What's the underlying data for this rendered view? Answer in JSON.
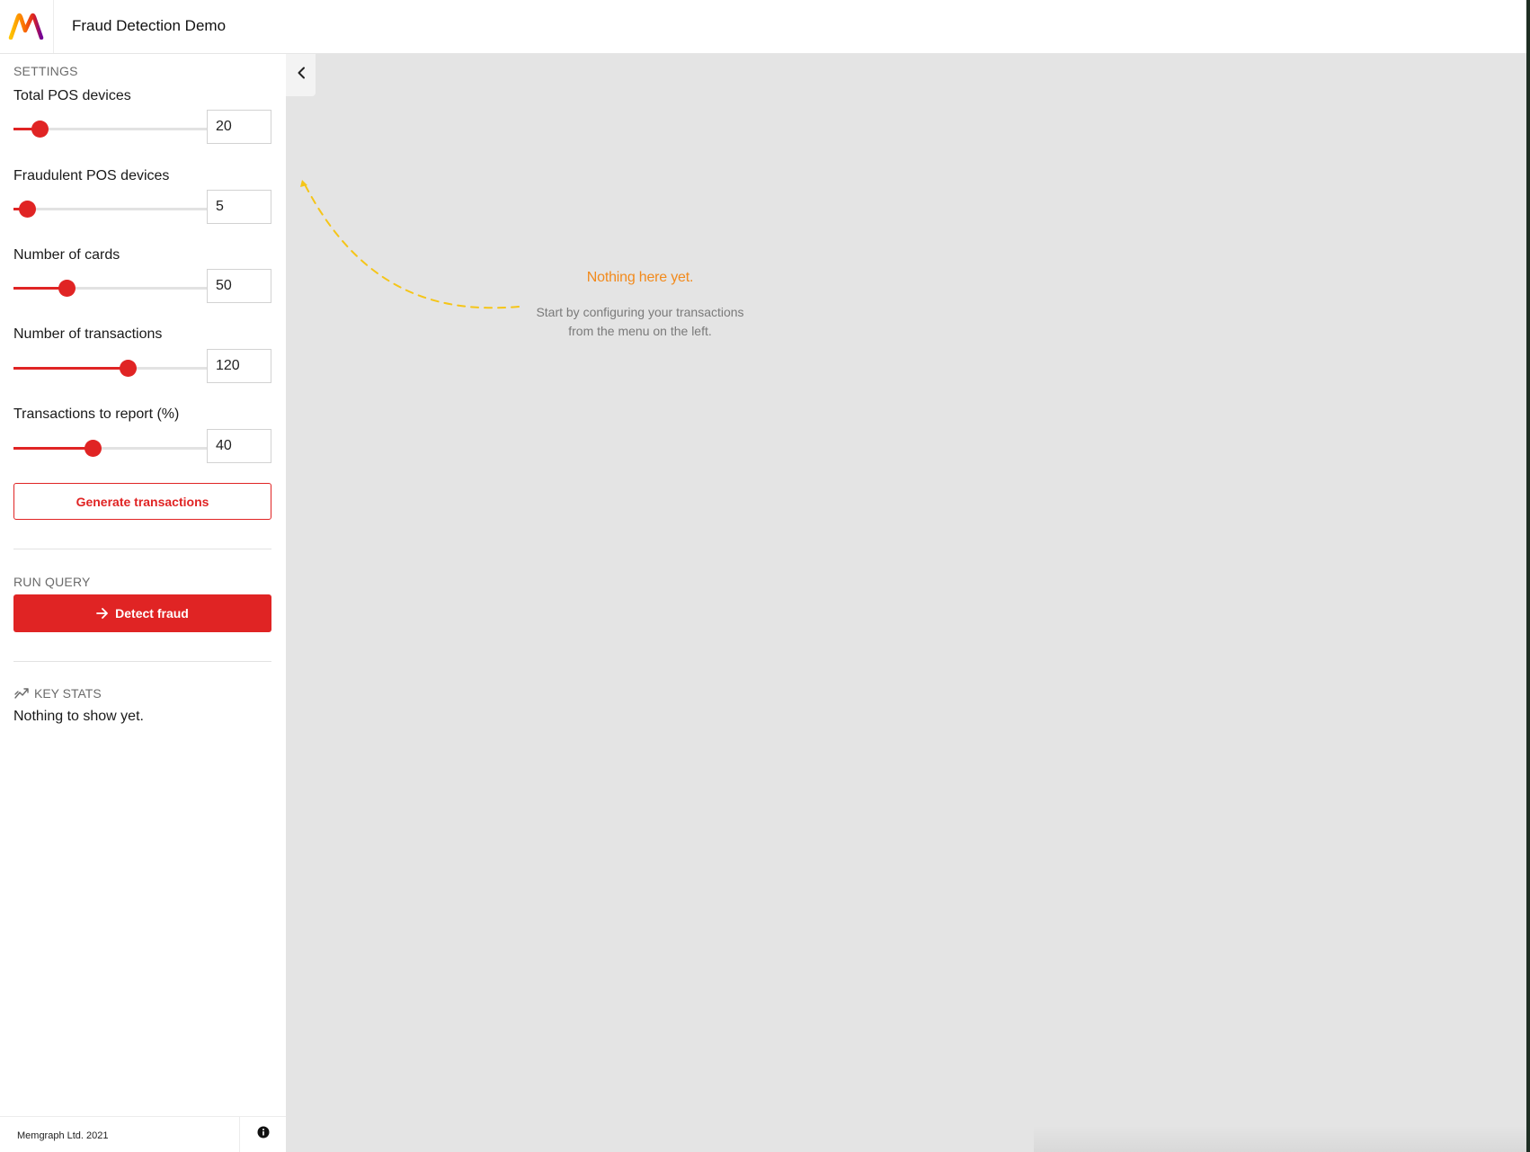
{
  "header": {
    "app_title": "Fraud Detection Demo"
  },
  "sidebar": {
    "settings_heading": "SETTINGS",
    "sliders": [
      {
        "label": "Total POS devices",
        "value": "20",
        "fill_fraction": 0.14
      },
      {
        "label": "Fraudulent POS devices",
        "value": "5",
        "fill_fraction": 0.07
      },
      {
        "label": "Number of cards",
        "value": "50",
        "fill_fraction": 0.28
      },
      {
        "label": "Number of transactions",
        "value": "120",
        "fill_fraction": 0.6
      },
      {
        "label": "Transactions to report (%)",
        "value": "40",
        "fill_fraction": 0.42
      }
    ],
    "generate_label": "Generate transactions",
    "run_query_heading": "RUN QUERY",
    "detect_label": "Detect fraud",
    "key_stats_heading": "KEY STATS",
    "key_stats_empty": "Nothing to show yet."
  },
  "footer": {
    "copyright": "Memgraph Ltd. 2021"
  },
  "main": {
    "empty_title": "Nothing here yet.",
    "empty_desc_line1": "Start by configuring your transactions",
    "empty_desc_line2": "from the menu on the left."
  },
  "colors": {
    "accent": "#e02424",
    "empty_title": "#f28a1c",
    "curve": "#f5c518",
    "background": "#e4e4e4"
  },
  "icons": {
    "logo": "memgraph-logo",
    "collapse": "chevron-left-icon",
    "detect": "arrow-right-icon",
    "stats": "trend-chart-icon",
    "info": "info-circle-icon"
  }
}
